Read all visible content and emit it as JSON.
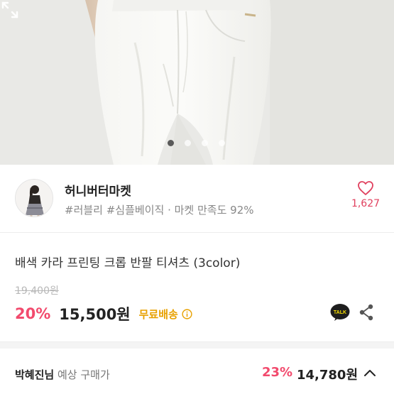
{
  "hero": {
    "image_description": "white wide-leg jeans photo",
    "carousel": {
      "count": 4,
      "active_index": 0
    }
  },
  "seller": {
    "name": "허니버터마켓",
    "meta": "#러블리 #심플베이직 · 마켓 만족도 92%",
    "likes": "1,627"
  },
  "product": {
    "title": "배색 카라 프린팅 크롭 반팔 티셔츠 (3color)",
    "original_price": "19,400원",
    "discount": "20%",
    "price": "15,500원",
    "shipping": "무료배송"
  },
  "purchase": {
    "buyer_name": "박혜진님",
    "buyer_label": " 예상 구매가",
    "discount": "23%",
    "price": "14,780원"
  },
  "colors": {
    "accent_pink": "#f24a6d",
    "shipping_yellow": "#e8a100",
    "kakao_yellow": "#f9e000"
  }
}
